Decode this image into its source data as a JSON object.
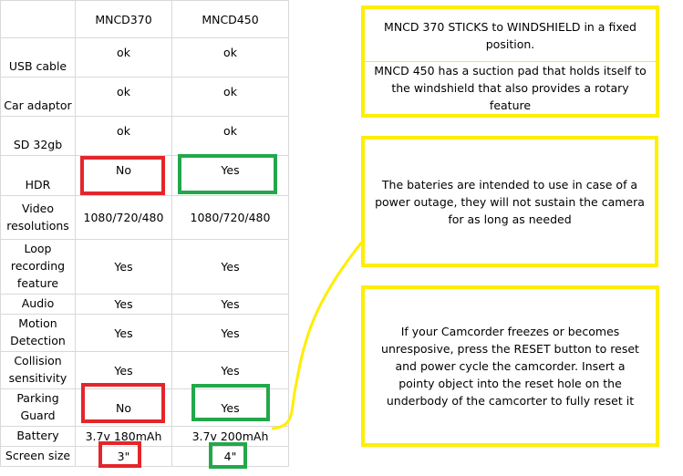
{
  "table": {
    "headers": [
      "",
      "MNCD370",
      "MNCD450"
    ],
    "rows": [
      {
        "label": "USB cable",
        "mncd370": "ok",
        "mncd450": "ok"
      },
      {
        "label": "Car adaptor",
        "mncd370": "ok",
        "mncd450": "ok"
      },
      {
        "label": "SD 32gb",
        "mncd370": "ok",
        "mncd450": "ok"
      },
      {
        "label": "HDR",
        "mncd370": "No",
        "mncd450": "Yes"
      },
      {
        "label": "Video resolutions",
        "mncd370": "1080/720/480",
        "mncd450": "1080/720/480"
      },
      {
        "label": "Loop recording feature",
        "mncd370": "Yes",
        "mncd450": "Yes"
      },
      {
        "label": "Audio",
        "mncd370": "Yes",
        "mncd450": "Yes"
      },
      {
        "label": "Motion Detection",
        "mncd370": "Yes",
        "mncd450": "Yes"
      },
      {
        "label": "Collision sensitivity",
        "mncd370": "Yes",
        "mncd450": "Yes"
      },
      {
        "label": "Parking Guard",
        "mncd370": "No",
        "mncd450": "Yes"
      },
      {
        "label": "Battery",
        "mncd370": "3.7v 180mAh",
        "mncd450": "3.7v 200mAh"
      },
      {
        "label": "Screen size",
        "mncd370": "3\"",
        "mncd450": "4\""
      }
    ]
  },
  "notes": {
    "mount_370": "MNCD 370 STICKS to WINDSHIELD in a fixed position.",
    "mount_450": "MNCD 450 has a suction pad that holds itself to the windshield that also provides a rotary feature",
    "battery": "The bateries are intended to use in case of a power outage, they will not sustain the camera for as long as needed",
    "reset": "If your Camcorder freezes or becomes unresposive, press the RESET button to reset and power cycle the camcorder. Insert a pointy object into the reset hole on the underbody of the camcorter to fully reset it"
  },
  "colors": {
    "highlight_no": "#e3262b",
    "highlight_yes": "#22a84a",
    "note_border": "#ffee00",
    "grid": "#d9d9d9"
  }
}
